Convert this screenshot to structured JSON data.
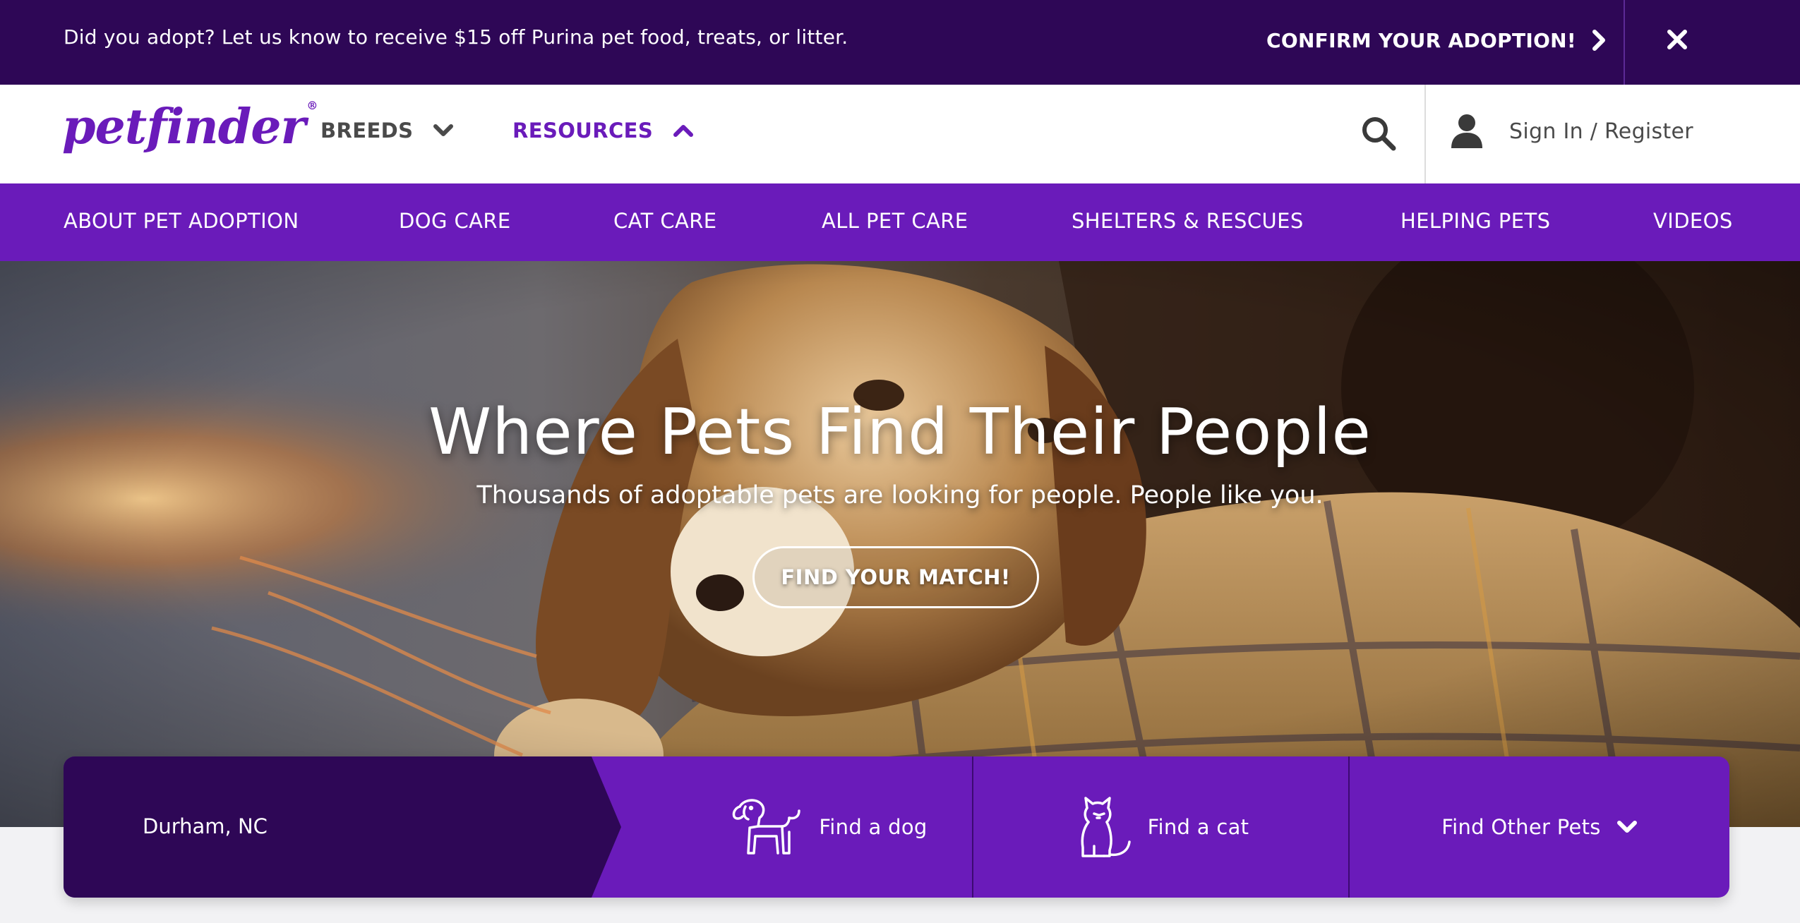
{
  "promo": {
    "text": "Did you adopt? Let us know to receive $15 off Purina pet food, treats, or litter.",
    "cta_label": "CONFIRM YOUR ADOPTION!"
  },
  "header": {
    "logo": "petfinder",
    "nav": [
      {
        "label": "BREEDS",
        "icon": "chevron-down-icon"
      },
      {
        "label": "RESOURCES",
        "icon": "chevron-up-icon"
      }
    ],
    "account_label": "Sign In / Register"
  },
  "subnav": [
    "ABOUT PET ADOPTION",
    "DOG CARE",
    "CAT CARE",
    "ALL PET CARE",
    "SHELTERS & RESCUES",
    "HELPING PETS",
    "VIDEOS"
  ],
  "hero": {
    "title": "Where Pets Find Their People",
    "subtitle": "Thousands of adoptable pets are looking for people. People like you.",
    "button": "FIND YOUR MATCH!"
  },
  "finder": {
    "location": "Durham, NC",
    "options": [
      "Find a dog",
      "Find a cat",
      "Find Other Pets"
    ]
  },
  "colors": {
    "brand_purple": "#6a1bba",
    "dark_purple": "#2e0756",
    "white": "#ffffff"
  }
}
